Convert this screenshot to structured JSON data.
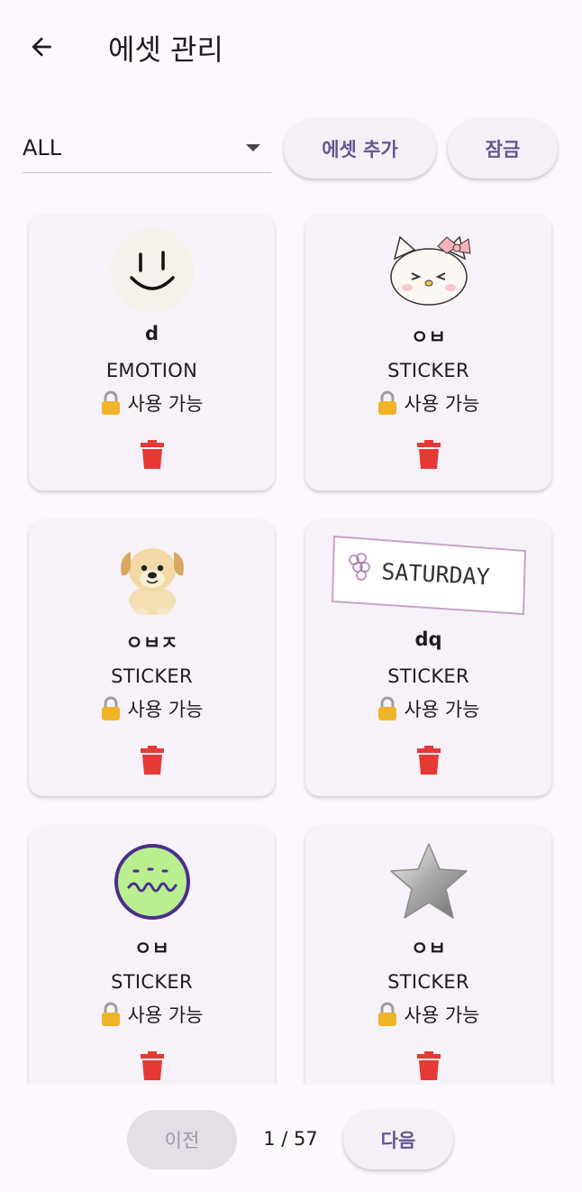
{
  "appbar": {
    "title": "에셋 관리"
  },
  "filter": {
    "value": "ALL"
  },
  "actions": {
    "add_label": "에셋 추가",
    "lock_label": "잠금"
  },
  "cards": [
    {
      "name": "d",
      "type": "EMOTION",
      "status": "사용 가능",
      "thumb": "smiley-face-image"
    },
    {
      "name": "ㅇㅂ",
      "type": "STICKER",
      "status": "사용 가능",
      "thumb": "hello-kitty-image"
    },
    {
      "name": "ㅇㅂㅈ",
      "type": "STICKER",
      "status": "사용 가능",
      "thumb": "puppy-image"
    },
    {
      "name": "dq",
      "type": "STICKER",
      "status": "사용 가능",
      "thumb": "saturday-label-image",
      "thumb_text": "SATURDAY"
    },
    {
      "name": "ㅇㅂ",
      "type": "STICKER",
      "status": "사용 가능",
      "thumb": "green-smile-circle-image"
    },
    {
      "name": "ㅇㅂ",
      "type": "STICKER",
      "status": "사용 가능",
      "thumb": "silver-star-image"
    }
  ],
  "pager": {
    "prev_label": "이전",
    "next_label": "다음",
    "page_text": "1 / 57"
  },
  "colors": {
    "accent": "#65558f",
    "background": "#fdf7fe",
    "card": "#f7f2fa",
    "delete": "#e53935",
    "lock": "#f0b429"
  }
}
